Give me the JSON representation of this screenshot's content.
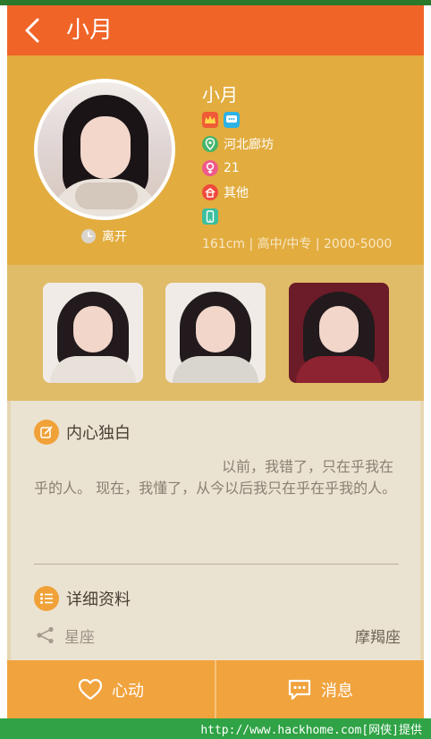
{
  "header": {
    "title": "小月"
  },
  "profile": {
    "status": "离开",
    "name": "小月",
    "location": "河北廊坊",
    "age": "21",
    "other": "其他",
    "stats": "161cm | 高中/中专 | 2000-5000"
  },
  "monologue": {
    "title": "内心独白",
    "text": "以前，我错了，只在乎我在乎的人。 现在，我懂了，从今以后我只在乎在乎我的人。"
  },
  "details": {
    "title": "详细资料",
    "rows": [
      {
        "label": "星座",
        "value": "摩羯座"
      }
    ]
  },
  "bottom": {
    "like_label": "心动",
    "message_label": "消息"
  },
  "footer": {
    "text": "http://www.hackhome.com[网侠]提供"
  },
  "colors": {
    "header": "#f06428",
    "profile_bg": "#e2ac3f",
    "photos_bg": "#e0bb68",
    "content_bg": "#ebe3d1",
    "bottom_bar": "#f1a33e",
    "footer": "#2fa345"
  },
  "icons": {
    "back": "chevron-left-icon",
    "clock": "clock-icon",
    "vip": "crown-icon",
    "chat": "chat-icon",
    "location": "location-pin-icon",
    "gender": "female-icon",
    "marital": "house-icon",
    "phone": "phone-icon",
    "edit": "pencil-icon",
    "list": "list-icon",
    "zodiac": "share-nodes-icon",
    "heart": "heart-icon",
    "message": "message-icon"
  }
}
